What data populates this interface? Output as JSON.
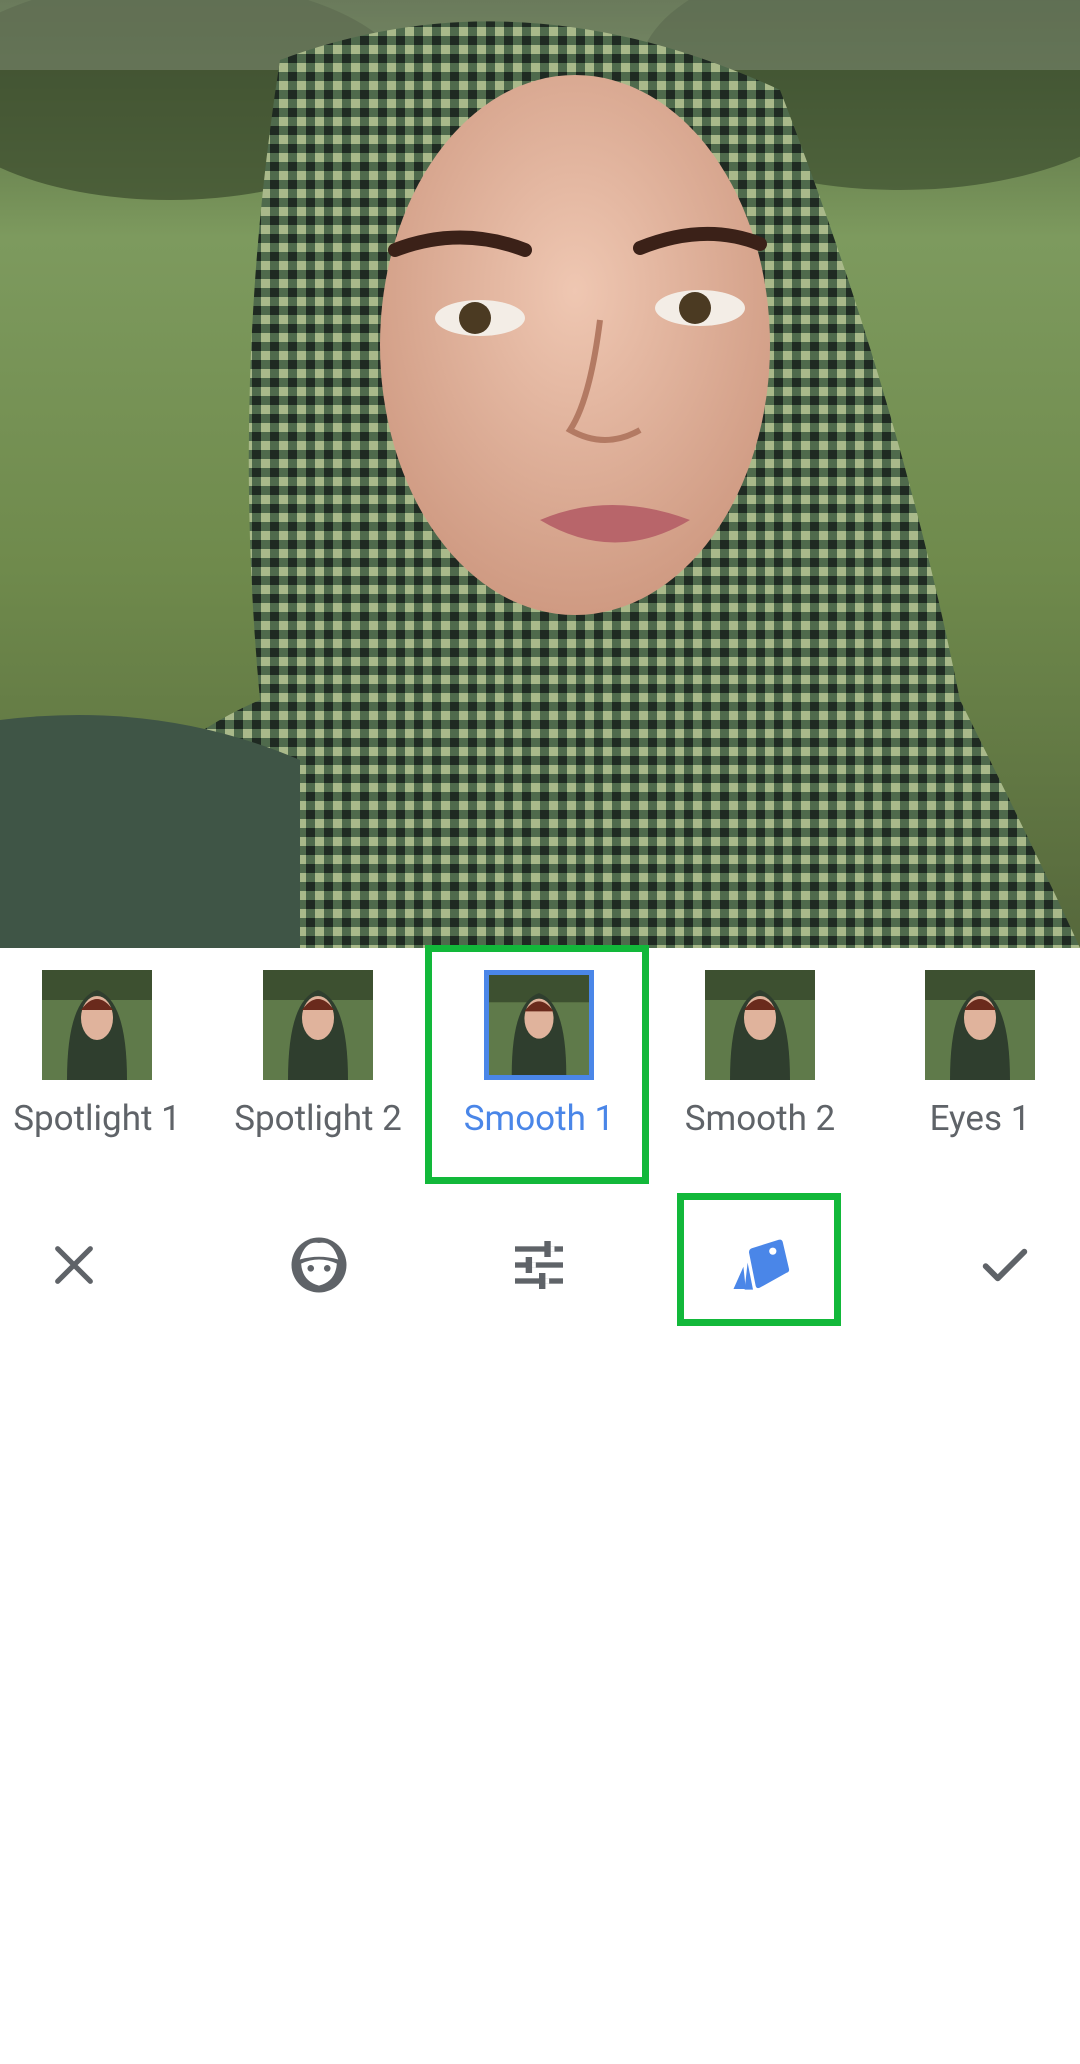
{
  "colors": {
    "accent": "#4a86e8",
    "highlight": "#12b83a",
    "icon": "#5f6368",
    "label": "#5f6368"
  },
  "photo": {
    "subject": "portrait-photo"
  },
  "presets": [
    {
      "label": "Spotlight 1",
      "selected": false
    },
    {
      "label": "Spotlight 2",
      "selected": false
    },
    {
      "label": "Smooth 1",
      "selected": true
    },
    {
      "label": "Smooth 2",
      "selected": false
    },
    {
      "label": "Eyes 1",
      "selected": false
    }
  ],
  "toolbar": {
    "items": [
      {
        "icon": "close-icon"
      },
      {
        "icon": "face-icon"
      },
      {
        "icon": "tune-sliders-icon"
      },
      {
        "icon": "styles-cards-icon",
        "selected": true
      },
      {
        "icon": "check-icon"
      }
    ]
  }
}
